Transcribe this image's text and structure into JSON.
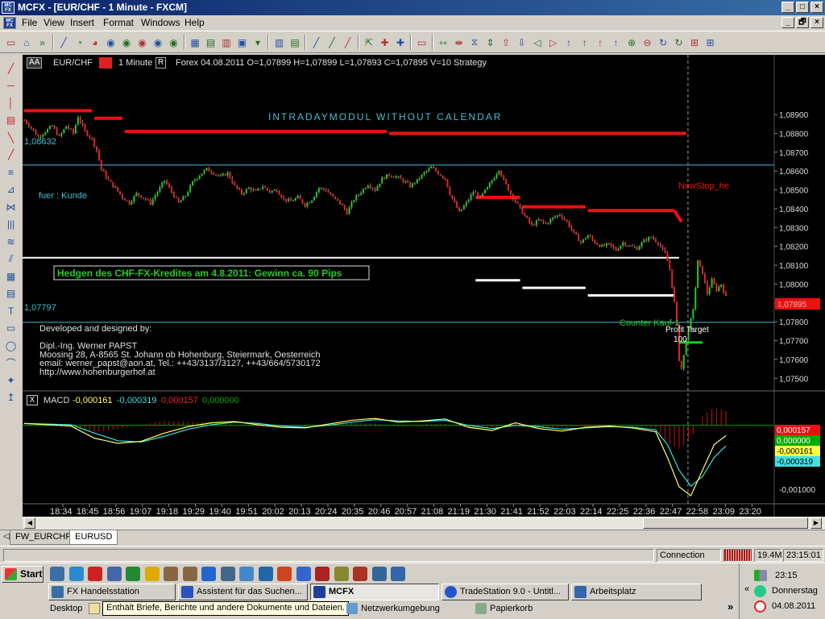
{
  "window": {
    "app_icon": "MC FX",
    "title": "MCFX - [EUR/CHF - 1 Minute - FXCM]",
    "min": "_",
    "max": "□",
    "close": "×",
    "child_min": "_",
    "child_max": "🗗",
    "child_close": "×"
  },
  "menu": [
    "File",
    "View",
    "Insert",
    "Format",
    "Windows",
    "Help"
  ],
  "chart_header": {
    "aa": "AA",
    "symbol": "EUR/CHF",
    "timeframe": "1 Minute",
    "r": "R",
    "info": "Forex  04.08.2011  O=1,07899  H=1,07899  L=1,07893  C=1,07895  V=10  Strategy"
  },
  "annotations": {
    "intraday": "INTRADAYMODUL WITHOUT CALENDAR",
    "level_high": "1,08632",
    "level_low": "1,07797",
    "fuer_kunde": "fuer : Kunde",
    "hedge_box": "Hedgen des CHF-FX-Kredites am 4.8.2011: Gewinn ca. 90 Pips",
    "newstop": "NewStop_he",
    "counter": "Counter Kauf-1",
    "profit": "Profit Target",
    "profit_val": "100",
    "credits": [
      "Developed and designed by:",
      "",
      "Dipl.-Ing. Werner PAPST",
      "Moosing 28, A-8565 St. Johann ob Hohenburg, Steiermark, Oesterreich",
      "email: werner_papst@aon.at, Tel.: ++43/3137/3127, ++43/664/5730172",
      "http://www.hohenburgerhof.at"
    ]
  },
  "macd_header": {
    "close": "X",
    "label": "MACD",
    "v1": "-0,000161",
    "v2": "-0,000319",
    "v3": "0,000157",
    "v4": "0,000000"
  },
  "colors": {
    "bull": "#22cc22",
    "bear": "#ee2020",
    "stop": "#ee1010",
    "cyan": "#40c0d0",
    "macd": "#ffff60",
    "signal": "#40e0e0",
    "hist": "#cc1010",
    "zero": "#00aa00"
  },
  "chart_data": {
    "type": "candlestick",
    "y_ticks": [
      "1,08900",
      "1,08800",
      "1,08700",
      "1,08600",
      "1,08500",
      "1,08400",
      "1,08300",
      "1,08200",
      "1,08100",
      "1,08000",
      "1,07900",
      "1,07800",
      "1,07700",
      "1,07600",
      "1,07500"
    ],
    "y_range": [
      1.0745,
      1.0911
    ],
    "last_price": "1,07895",
    "x_ticks": [
      "18:34",
      "18:45",
      "18:56",
      "19:07",
      "19:18",
      "19:29",
      "19:40",
      "19:51",
      "20:02",
      "20:13",
      "20:24",
      "20:35",
      "20:46",
      "20:57",
      "21:08",
      "21:19",
      "21:30",
      "21:41",
      "21:52",
      "22:03",
      "22:14",
      "22:25",
      "22:36",
      "22:47",
      "22:58",
      "23:09",
      "23:20"
    ],
    "close_path": [
      [
        0,
        1.0887
      ],
      [
        3,
        1.0883
      ],
      [
        6,
        1.0878
      ],
      [
        9,
        1.0881
      ],
      [
        12,
        1.0884
      ],
      [
        15,
        1.0878
      ],
      [
        18,
        1.0884
      ],
      [
        21,
        1.088
      ],
      [
        23,
        1.0889
      ],
      [
        26,
        1.0881
      ],
      [
        29,
        1.0877
      ],
      [
        31,
        1.0871
      ],
      [
        33,
        1.0861
      ],
      [
        36,
        1.0855
      ],
      [
        39,
        1.0851
      ],
      [
        42,
        1.0846
      ],
      [
        45,
        1.0843
      ],
      [
        48,
        1.0848
      ],
      [
        51,
        1.0846
      ],
      [
        54,
        1.0843
      ],
      [
        57,
        1.0849
      ],
      [
        60,
        1.0855
      ],
      [
        63,
        1.0849
      ],
      [
        66,
        1.0843
      ],
      [
        69,
        1.0847
      ],
      [
        72,
        1.0854
      ],
      [
        75,
        1.0858
      ],
      [
        78,
        1.0861
      ],
      [
        81,
        1.0859
      ],
      [
        84,
        1.0857
      ],
      [
        87,
        1.0859
      ],
      [
        90,
        1.0852
      ],
      [
        93,
        1.0848
      ],
      [
        96,
        1.0851
      ],
      [
        99,
        1.0849
      ],
      [
        102,
        1.0852
      ],
      [
        105,
        1.0849
      ],
      [
        108,
        1.085
      ],
      [
        111,
        1.0845
      ],
      [
        114,
        1.0844
      ],
      [
        117,
        1.0846
      ],
      [
        120,
        1.0842
      ],
      [
        123,
        1.0845
      ],
      [
        126,
        1.0851
      ],
      [
        129,
        1.085
      ],
      [
        132,
        1.0846
      ],
      [
        135,
        1.0843
      ],
      [
        138,
        1.0838
      ],
      [
        141,
        1.0845
      ],
      [
        144,
        1.0849
      ],
      [
        147,
        1.0853
      ],
      [
        150,
        1.085
      ],
      [
        153,
        1.0856
      ],
      [
        156,
        1.0858
      ],
      [
        159,
        1.0857
      ],
      [
        162,
        1.0855
      ],
      [
        165,
        1.0852
      ],
      [
        168,
        1.0855
      ],
      [
        171,
        1.0859
      ],
      [
        174,
        1.0862
      ],
      [
        177,
        1.0859
      ],
      [
        180,
        1.0856
      ],
      [
        182,
        1.0848
      ],
      [
        184,
        1.0843
      ],
      [
        186,
        1.0838
      ],
      [
        189,
        1.0843
      ],
      [
        192,
        1.0849
      ],
      [
        195,
        1.0846
      ],
      [
        198,
        1.0851
      ],
      [
        201,
        1.0857
      ],
      [
        203,
        1.0861
      ],
      [
        205,
        1.0855
      ],
      [
        208,
        1.0848
      ],
      [
        211,
        1.0842
      ],
      [
        214,
        1.0836
      ],
      [
        217,
        1.0831
      ],
      [
        220,
        1.0834
      ],
      [
        223,
        1.0832
      ],
      [
        226,
        1.0835
      ],
      [
        229,
        1.0837
      ],
      [
        232,
        1.0833
      ],
      [
        235,
        1.0827
      ],
      [
        238,
        1.0822
      ],
      [
        241,
        1.0826
      ],
      [
        244,
        1.0822
      ],
      [
        247,
        1.082
      ],
      [
        250,
        1.0821
      ],
      [
        253,
        1.0818
      ],
      [
        256,
        1.0822
      ],
      [
        259,
        1.082
      ],
      [
        262,
        1.0819
      ],
      [
        265,
        1.0823
      ],
      [
        268,
        1.0825
      ],
      [
        271,
        1.0822
      ],
      [
        274,
        1.0816
      ],
      [
        276,
        1.0808
      ],
      [
        278,
        1.079
      ],
      [
        279,
        1.0778
      ],
      [
        280,
        1.076
      ],
      [
        281,
        1.0755
      ],
      [
        282,
        1.0762
      ],
      [
        283,
        1.0771
      ],
      [
        284,
        1.0775
      ],
      [
        286,
        1.0787
      ],
      [
        287,
        1.0798
      ],
      [
        288,
        1.0812
      ],
      [
        290,
        1.0806
      ],
      [
        292,
        1.0795
      ],
      [
        294,
        1.0802
      ],
      [
        296,
        1.0797
      ],
      [
        298,
        1.08
      ],
      [
        300,
        1.0793
      ]
    ],
    "stop_upper": [
      {
        "x1": 0,
        "x2": 29,
        "y": 1.0892
      },
      {
        "x1": 30,
        "x2": 42,
        "y": 1.0888
      },
      {
        "x1": 43,
        "x2": 155,
        "y": 1.0881
      },
      {
        "x1": 156,
        "x2": 283,
        "y": 1.088
      },
      {
        "x1": 193,
        "x2": 212,
        "y": 1.0846
      },
      {
        "x1": 213,
        "x2": 240,
        "y": 1.0841
      },
      {
        "x1": 241,
        "x2": 278,
        "y": 1.0839
      }
    ],
    "stop_lower": [
      {
        "x1": 193,
        "x2": 212,
        "y": 1.0802
      },
      {
        "x1": 213,
        "x2": 240,
        "y": 1.0798
      },
      {
        "x1": 241,
        "x2": 278,
        "y": 1.0794
      }
    ],
    "white_level": 1.0814,
    "cyan_high": 1.08632,
    "cyan_low": 1.07797,
    "profit_line": {
      "x1": 280,
      "x2": 290,
      "y": 1.0769
    },
    "macd": {
      "y_ticks": [
        "-0,001000"
      ],
      "y_range": [
        -0.0012,
        0.00035
      ],
      "macd_labels": [
        "0,000157",
        "0,000000",
        "-0,000161",
        "-0,000319"
      ],
      "macd_path": [
        [
          0,
          3e-05
        ],
        [
          20,
          -1e-05
        ],
        [
          30,
          -0.0002
        ],
        [
          40,
          -0.00028
        ],
        [
          50,
          -0.00025
        ],
        [
          60,
          -0.00012
        ],
        [
          70,
          -2e-05
        ],
        [
          80,
          4e-05
        ],
        [
          90,
          6e-05
        ],
        [
          100,
          1e-05
        ],
        [
          110,
          -3e-05
        ],
        [
          120,
          -4e-05
        ],
        [
          130,
          2e-05
        ],
        [
          140,
          8e-05
        ],
        [
          150,
          0.00011
        ],
        [
          160,
          5e-05
        ],
        [
          170,
          7e-05
        ],
        [
          180,
          0.0001
        ],
        [
          190,
          -3e-05
        ],
        [
          200,
          -8e-05
        ],
        [
          210,
          4e-05
        ],
        [
          220,
          -5e-05
        ],
        [
          230,
          -9e-05
        ],
        [
          240,
          -3e-05
        ],
        [
          250,
          -1e-05
        ],
        [
          260,
          -4e-05
        ],
        [
          270,
          -0.0001
        ],
        [
          275,
          -0.0005
        ],
        [
          280,
          -0.00096
        ],
        [
          285,
          -0.0011
        ],
        [
          290,
          -0.0007
        ],
        [
          295,
          -0.0003
        ],
        [
          300,
          -0.00016
        ]
      ],
      "signal_path": [
        [
          0,
          3e-05
        ],
        [
          20,
          1e-05
        ],
        [
          30,
          -0.00012
        ],
        [
          40,
          -0.00024
        ],
        [
          50,
          -0.00026
        ],
        [
          60,
          -0.00017
        ],
        [
          70,
          -6e-05
        ],
        [
          80,
          1e-05
        ],
        [
          90,
          5e-05
        ],
        [
          100,
          3e-05
        ],
        [
          110,
          -1e-05
        ],
        [
          120,
          -3e-05
        ],
        [
          130,
          0.0
        ],
        [
          140,
          5e-05
        ],
        [
          150,
          9e-05
        ],
        [
          160,
          7e-05
        ],
        [
          170,
          6e-05
        ],
        [
          180,
          8e-05
        ],
        [
          190,
          0.0
        ],
        [
          200,
          -5e-05
        ],
        [
          210,
          0.0
        ],
        [
          220,
          -2e-05
        ],
        [
          230,
          -6e-05
        ],
        [
          240,
          -4e-05
        ],
        [
          250,
          -2e-05
        ],
        [
          260,
          -3e-05
        ],
        [
          270,
          -7e-05
        ],
        [
          275,
          -0.0003
        ],
        [
          280,
          -0.0007
        ],
        [
          285,
          -0.00095
        ],
        [
          290,
          -0.0008
        ],
        [
          295,
          -0.0005
        ],
        [
          300,
          -0.00032
        ]
      ]
    }
  },
  "sheet_tabs": [
    "FW_EURCHF",
    "EURUSD"
  ],
  "status": {
    "connection": "Connection OK",
    "memory": "19.4M",
    "time": "23:15:01"
  },
  "taskbar": {
    "start": "Start",
    "row1": [
      {
        "label": "FX Handelsstation",
        "icon": "#3a6ea5"
      },
      {
        "label": "Assistent für das Suchen...",
        "icon": "#2a52be"
      },
      {
        "label": "MCFX",
        "icon": "#1c3f9a"
      },
      {
        "label": "TradeStation 9.0 - Untitl...",
        "icon": "#2255cc"
      },
      {
        "label": "Arbeitsplatz",
        "icon": "#3366aa"
      }
    ],
    "desktop_label": "Desktop",
    "tooltip": "Enthält Briefe, Berichte und andere Dokumente und Dateien.",
    "row2": [
      {
        "label": "Netzwerkumgebung"
      },
      {
        "label": "Papierkorb"
      }
    ],
    "tray_time": "23:15",
    "tray_day": "Donnerstag",
    "tray_date": "04.08.2011",
    "chevron": "»",
    "tray_chev": "«"
  }
}
